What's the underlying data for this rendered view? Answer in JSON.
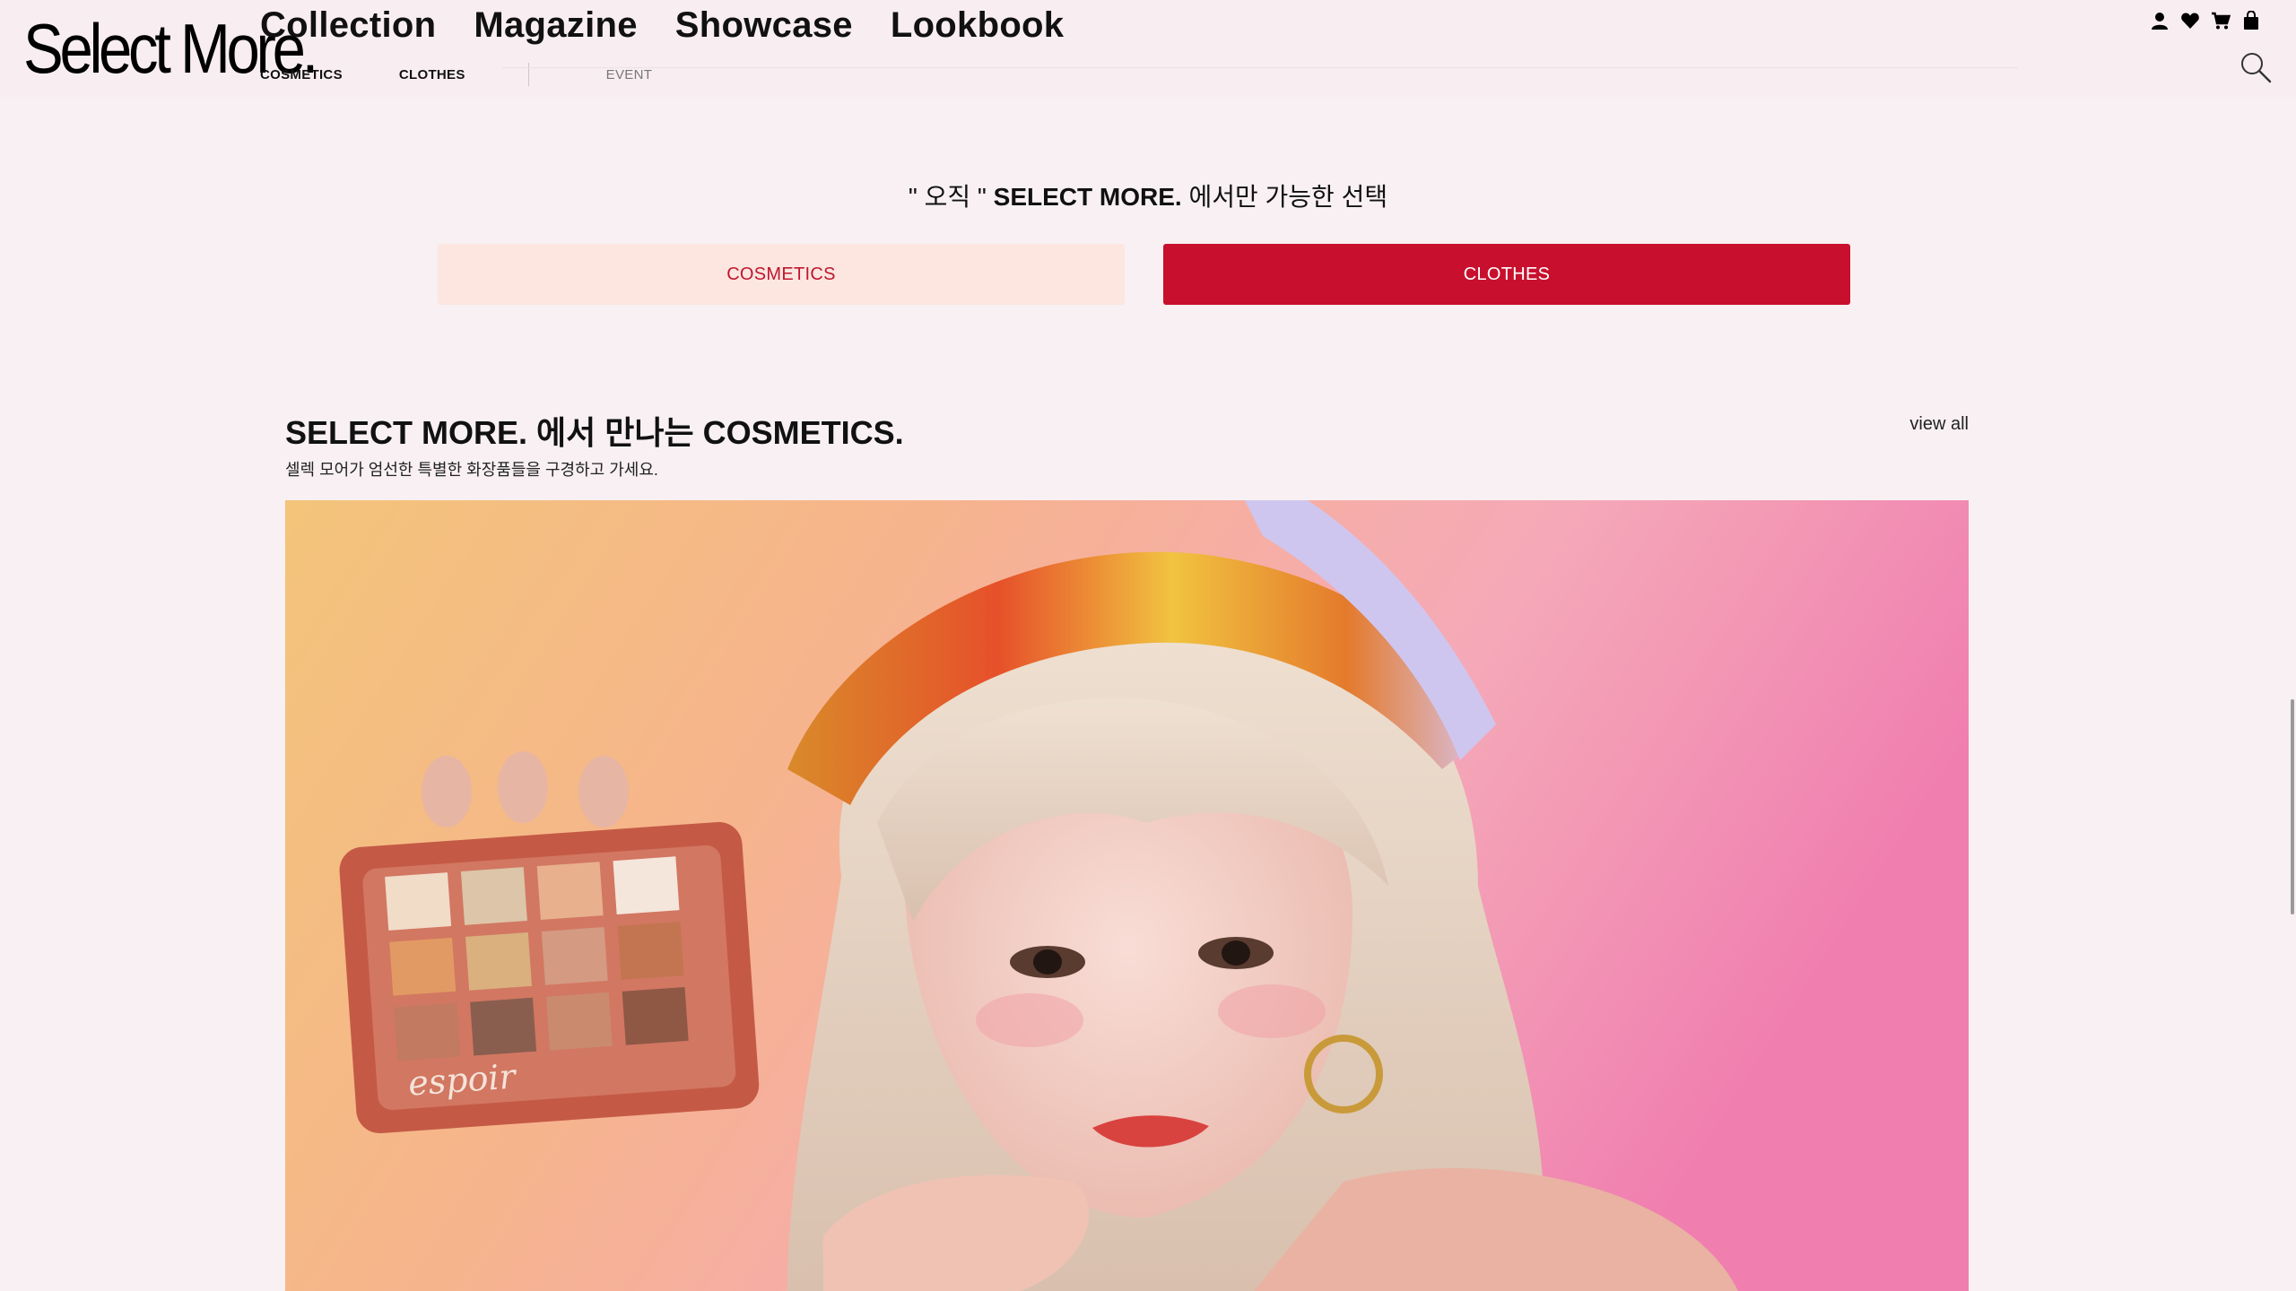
{
  "header": {
    "logo": "Select More.",
    "main_nav": [
      "Collection",
      "Magazine",
      "Showcase",
      "Lookbook"
    ],
    "sub_nav": {
      "cosmetics": "COSMETICS",
      "clothes": "CLOTHES",
      "event": "EVENT"
    },
    "icons": [
      "user-icon",
      "heart-icon",
      "cart-icon",
      "bag-icon",
      "search-icon"
    ]
  },
  "tagline": {
    "pre": "\" 오직 \" ",
    "brand": "SELECT MORE.",
    "post": " 에서만 가능한 선택"
  },
  "toggle": {
    "cosmetics": "COSMETICS",
    "clothes": "CLOTHES",
    "selected": "CLOTHES"
  },
  "section": {
    "title_brand": "SELECT MORE.",
    "title_rest": " 에서 만나는 COSMETICS.",
    "subtitle": "셀렉 모어가 엄선한 특별한 화장품들을 구경하고 가세요.",
    "view_all": "view all",
    "hero_brand_text": "espoir"
  },
  "colors": {
    "accent": "#c8102e",
    "accent_light": "#fce6df",
    "page_bg": "#f8f0f2"
  }
}
